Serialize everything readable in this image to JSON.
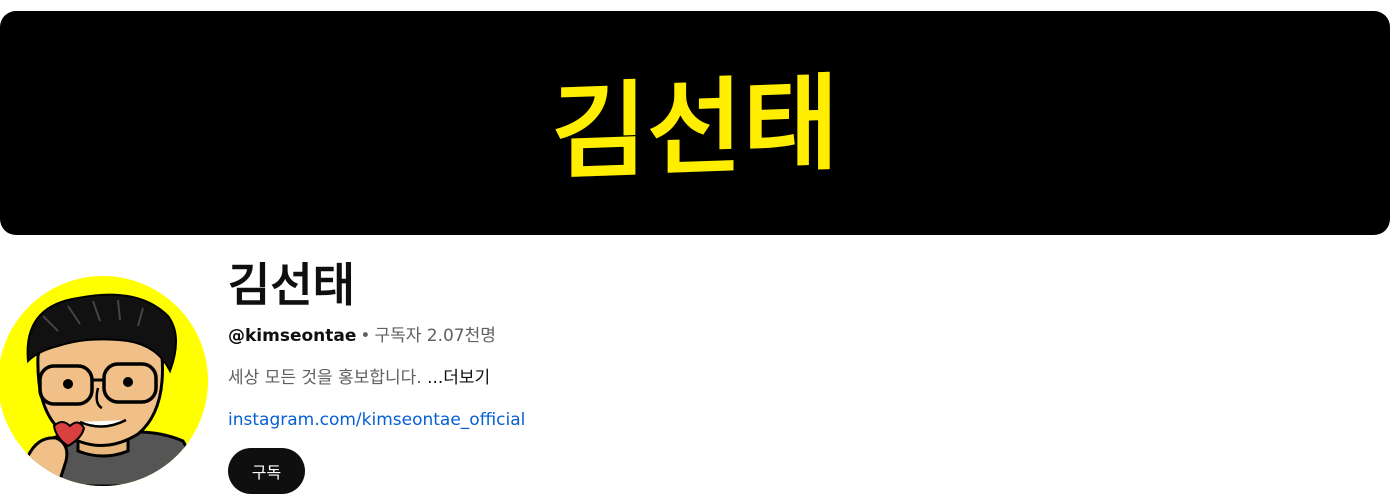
{
  "banner": {
    "logo_text": "김선태",
    "background": "#000000",
    "logo_color": "#ffee00"
  },
  "avatar": {
    "background": "#ffff00",
    "description": "caricature-avatar"
  },
  "channel": {
    "name": "김선태",
    "handle": "@kimseontae",
    "separator": "•",
    "subscribers": "구독자 2.07천명",
    "description": "세상 모든 것을 홍보합니다.",
    "more_label": "...더보기",
    "link": "instagram.com/kimseontae_official",
    "subscribe_label": "구독"
  },
  "colors": {
    "text_primary": "#0f0f0f",
    "text_secondary": "#606060",
    "link": "#065fd4",
    "button_bg": "#0f0f0f"
  }
}
